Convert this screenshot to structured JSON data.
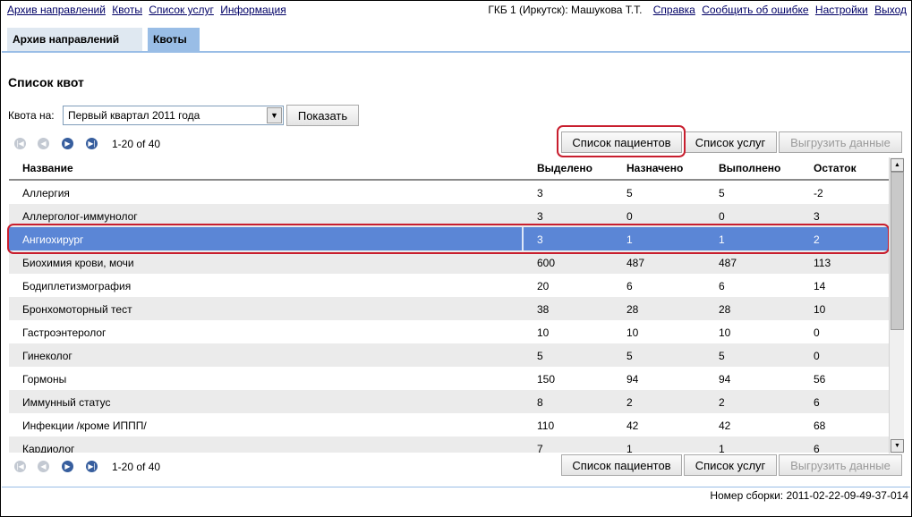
{
  "topnav": {
    "links": [
      "Архив направлений",
      "Квоты",
      "Список услуг",
      "Информация"
    ],
    "user": "ГКБ 1 (Иркутск): Машукова Т.Т.",
    "right_links": [
      "Справка",
      "Сообщить об ошибке",
      "Настройки",
      "Выход"
    ]
  },
  "tabs": [
    "Архив направлений",
    "Квоты"
  ],
  "page_title": "Список квот",
  "filter": {
    "label": "Квота на:",
    "selected": "Первый квартал 2011 года",
    "show_button": "Показать"
  },
  "pager": {
    "text": "1-20 of 40"
  },
  "actions": {
    "patients": "Список пациентов",
    "services": "Список услуг",
    "export": "Выгрузить данные"
  },
  "table": {
    "columns": [
      "Название",
      "Выделено",
      "Назначено",
      "Выполнено",
      "Остаток"
    ],
    "rows": [
      [
        "Аллергия",
        "3",
        "5",
        "5",
        "-2"
      ],
      [
        "Аллерголог-иммунолог",
        "3",
        "0",
        "0",
        "3"
      ],
      [
        "Ангиохирург",
        "3",
        "1",
        "1",
        "2"
      ],
      [
        "Биохимия крови, мочи",
        "600",
        "487",
        "487",
        "113"
      ],
      [
        "Бодиплетизмография",
        "20",
        "6",
        "6",
        "14"
      ],
      [
        "Бронхомоторный тест",
        "38",
        "28",
        "28",
        "10"
      ],
      [
        "Гастроэнтеролог",
        "10",
        "10",
        "10",
        "0"
      ],
      [
        "Гинеколог",
        "5",
        "5",
        "5",
        "0"
      ],
      [
        "Гормоны",
        "150",
        "94",
        "94",
        "56"
      ],
      [
        "Иммунный статус",
        "8",
        "2",
        "2",
        "6"
      ],
      [
        "Инфекции /кроме ИППП/",
        "110",
        "42",
        "42",
        "68"
      ],
      [
        "Кардиолог",
        "7",
        "1",
        "1",
        "6"
      ]
    ],
    "selected_row": 2
  },
  "footer": {
    "build": "Номер сборки: 2011-02-22-09-49-37-014"
  }
}
